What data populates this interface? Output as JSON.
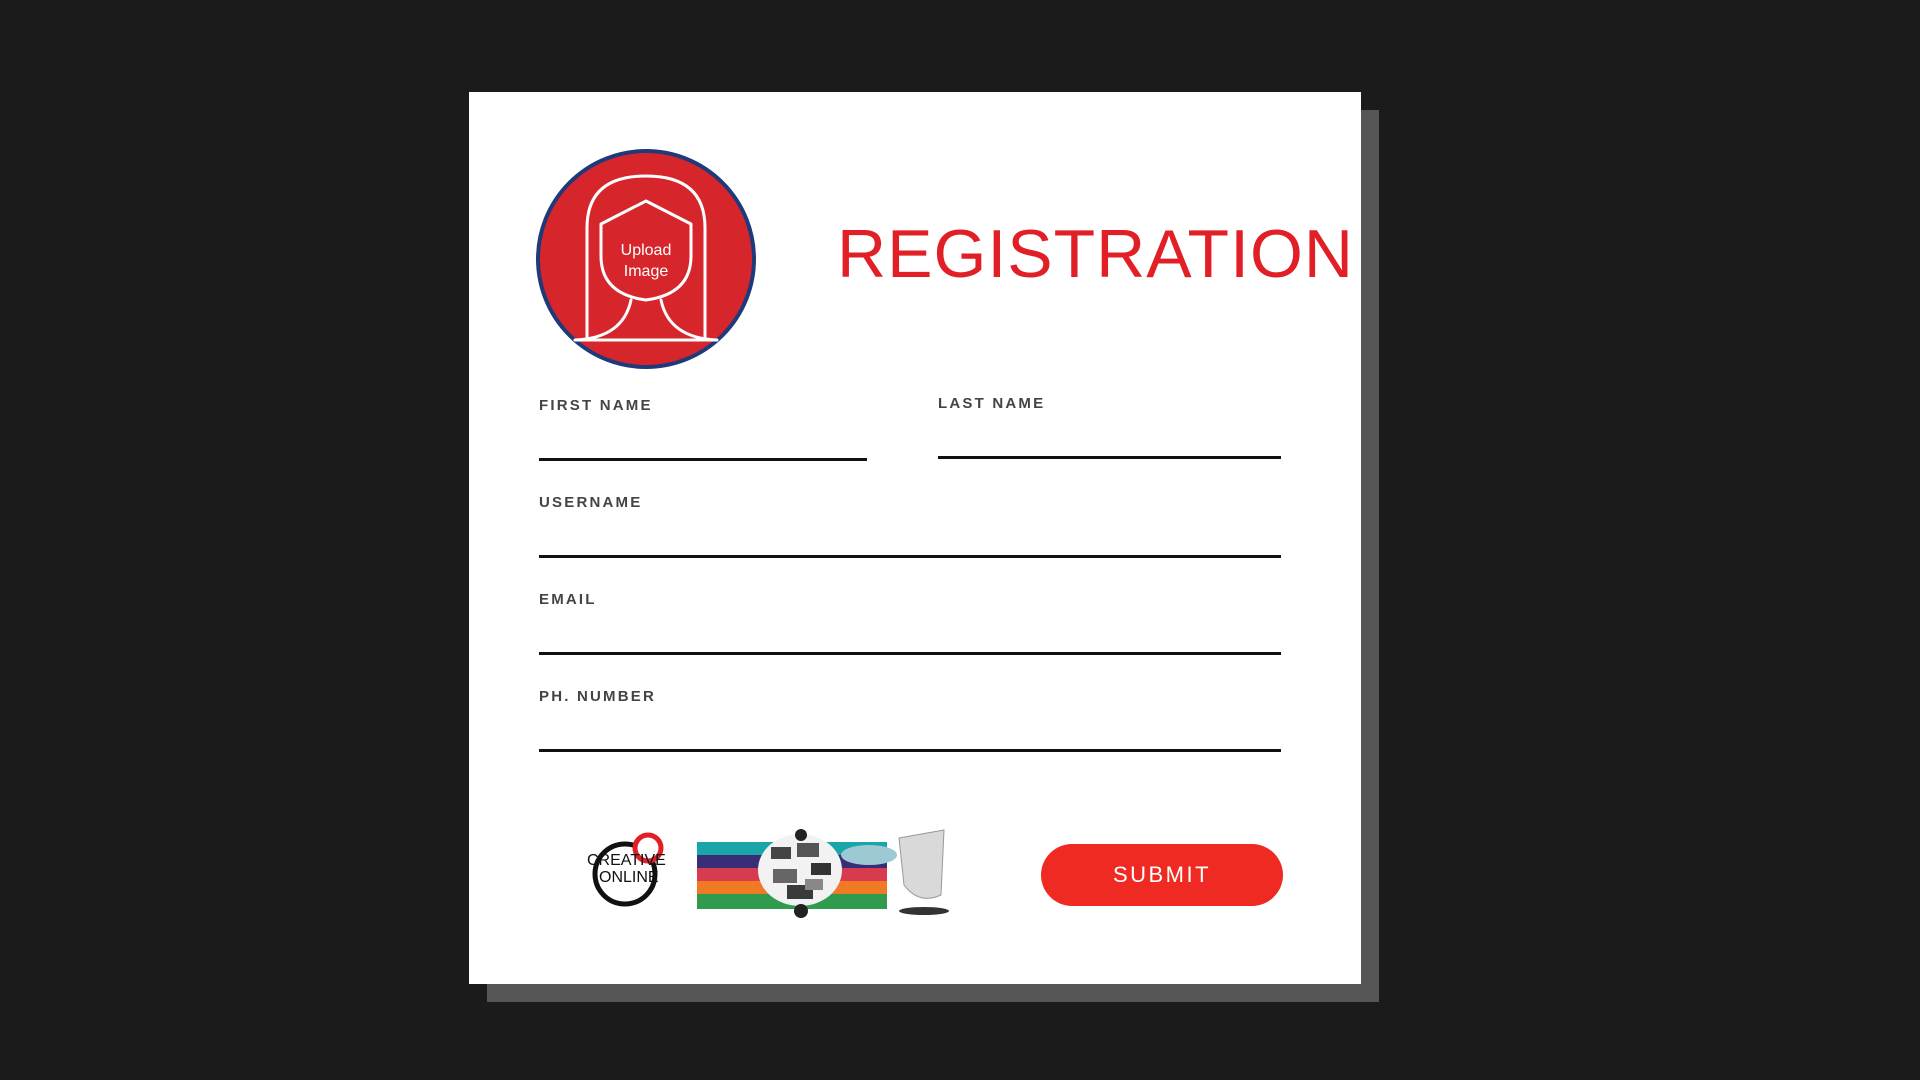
{
  "form": {
    "title": "REGISTRATION",
    "avatar": {
      "label_line1": "Upload",
      "label_line2": "Image",
      "icon": "person-silhouette-icon"
    },
    "fields": {
      "first_name": {
        "label": "FIRST NAME",
        "value": ""
      },
      "last_name": {
        "label": "LAST NAME",
        "value": ""
      },
      "username": {
        "label": "USERNAME",
        "value": ""
      },
      "email": {
        "label": "EMAIL",
        "value": ""
      },
      "phone": {
        "label": "PH. NUMBER",
        "value": ""
      }
    },
    "submit_label": "SUBMIT"
  },
  "branding": {
    "logo_line1": "CREATIVE",
    "logo_line2": "ONLINE"
  },
  "colors": {
    "accent": "#e11f26",
    "submit": "#ef2a22",
    "avatar_fill": "#d7262b",
    "avatar_ring": "#1f3a7a",
    "background": "#1b1b1b",
    "shadow": "#555555",
    "card": "#ffffff"
  }
}
